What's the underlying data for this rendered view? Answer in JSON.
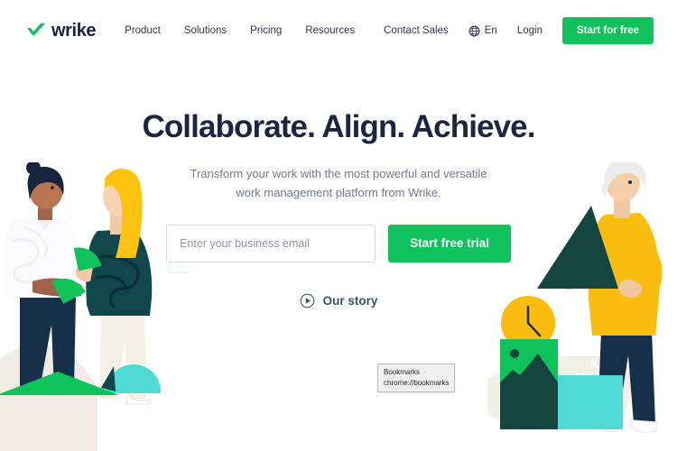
{
  "brand": {
    "name": "wrike",
    "logo_icon": "green-check-icon",
    "accent_green": "#0fc25b",
    "navy": "#1c2644",
    "teal_dark": "#14463f",
    "turquoise": "#4fdbd4",
    "yellow": "#ffc20e"
  },
  "header": {
    "nav_left": [
      {
        "label": "Product"
      },
      {
        "label": "Solutions"
      },
      {
        "label": "Pricing"
      },
      {
        "label": "Resources"
      }
    ],
    "contact_sales": "Contact Sales",
    "language": {
      "icon": "globe-icon",
      "label": "En"
    },
    "login": "Login",
    "cta": "Start for free"
  },
  "hero": {
    "headline": "Collaborate. Align. Achieve.",
    "subhead_line1": "Transform your work with the most powerful and versatile",
    "subhead_line2": "work management platform from Wrike.",
    "email": {
      "placeholder": "Enter your business email",
      "value": ""
    },
    "trial_button": "Start free trial",
    "story": {
      "icon": "play-circle-icon",
      "label": "Our story"
    }
  },
  "tooltip": {
    "title": "Bookmarks",
    "url": "chrome://bookmarks"
  },
  "illustrations": {
    "left": {
      "name": "two-people-collaborating-illustration",
      "figures": [
        "person-dark-hair-white-shirt",
        "person-blonde-teal-top"
      ],
      "shapes": [
        "green-semicircle",
        "green-triangle",
        "turquoise-dome",
        "beige-hill"
      ]
    },
    "right": {
      "name": "person-holding-triangle-illustration",
      "figures": [
        "person-white-hair-yellow-shirt"
      ],
      "shapes": [
        "dark-teal-triangle",
        "yellow-clock",
        "green-image-block",
        "turquoise-square",
        "beige-quarter-circle",
        "beige-circle"
      ]
    }
  }
}
